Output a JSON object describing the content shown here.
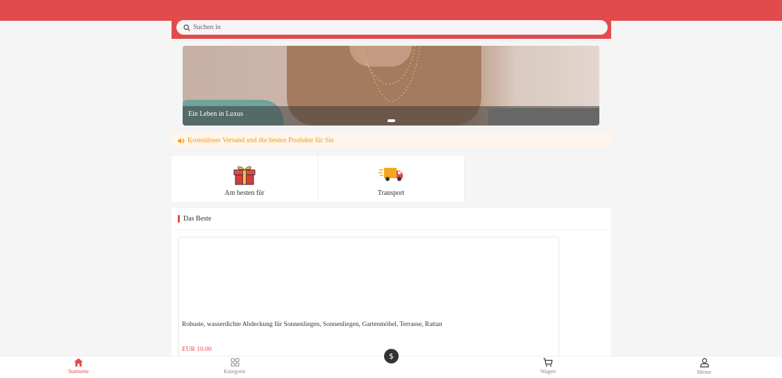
{
  "search": {
    "placeholder": "Suchen in"
  },
  "banner": {
    "caption": "Ein Leben in Luxus",
    "slides": 1,
    "active_slide": 1
  },
  "notice": {
    "text": "Kostenloser Versand und die besten Produkte für Sie",
    "icon": "speaker-icon",
    "color": "#f39c12"
  },
  "categories": [
    {
      "label": "Am besten für",
      "icon": "gift-icon"
    },
    {
      "label": "Transport",
      "icon": "delivery-truck-icon"
    }
  ],
  "section": {
    "title": "Das Beste"
  },
  "product": {
    "name": "Robuste, wasserdichte Abdeckung für Sonnenliegen, Sonnenliegen, Gartenmöbel, Terrasse, Rattan",
    "price": "EUR 10.00"
  },
  "tabbar": {
    "items": [
      {
        "label": "Startseite",
        "icon": "home-icon",
        "active": true
      },
      {
        "label": "Kategorie",
        "icon": "grid-icon",
        "active": false
      },
      {
        "label": "Wagen",
        "icon": "cart-icon",
        "active": false
      },
      {
        "label": "Meine",
        "icon": "user-icon",
        "active": false
      }
    ],
    "fab_symbol": "$"
  },
  "colors": {
    "brand": "#e24b4e",
    "notice_bg": "#fff5ea"
  }
}
